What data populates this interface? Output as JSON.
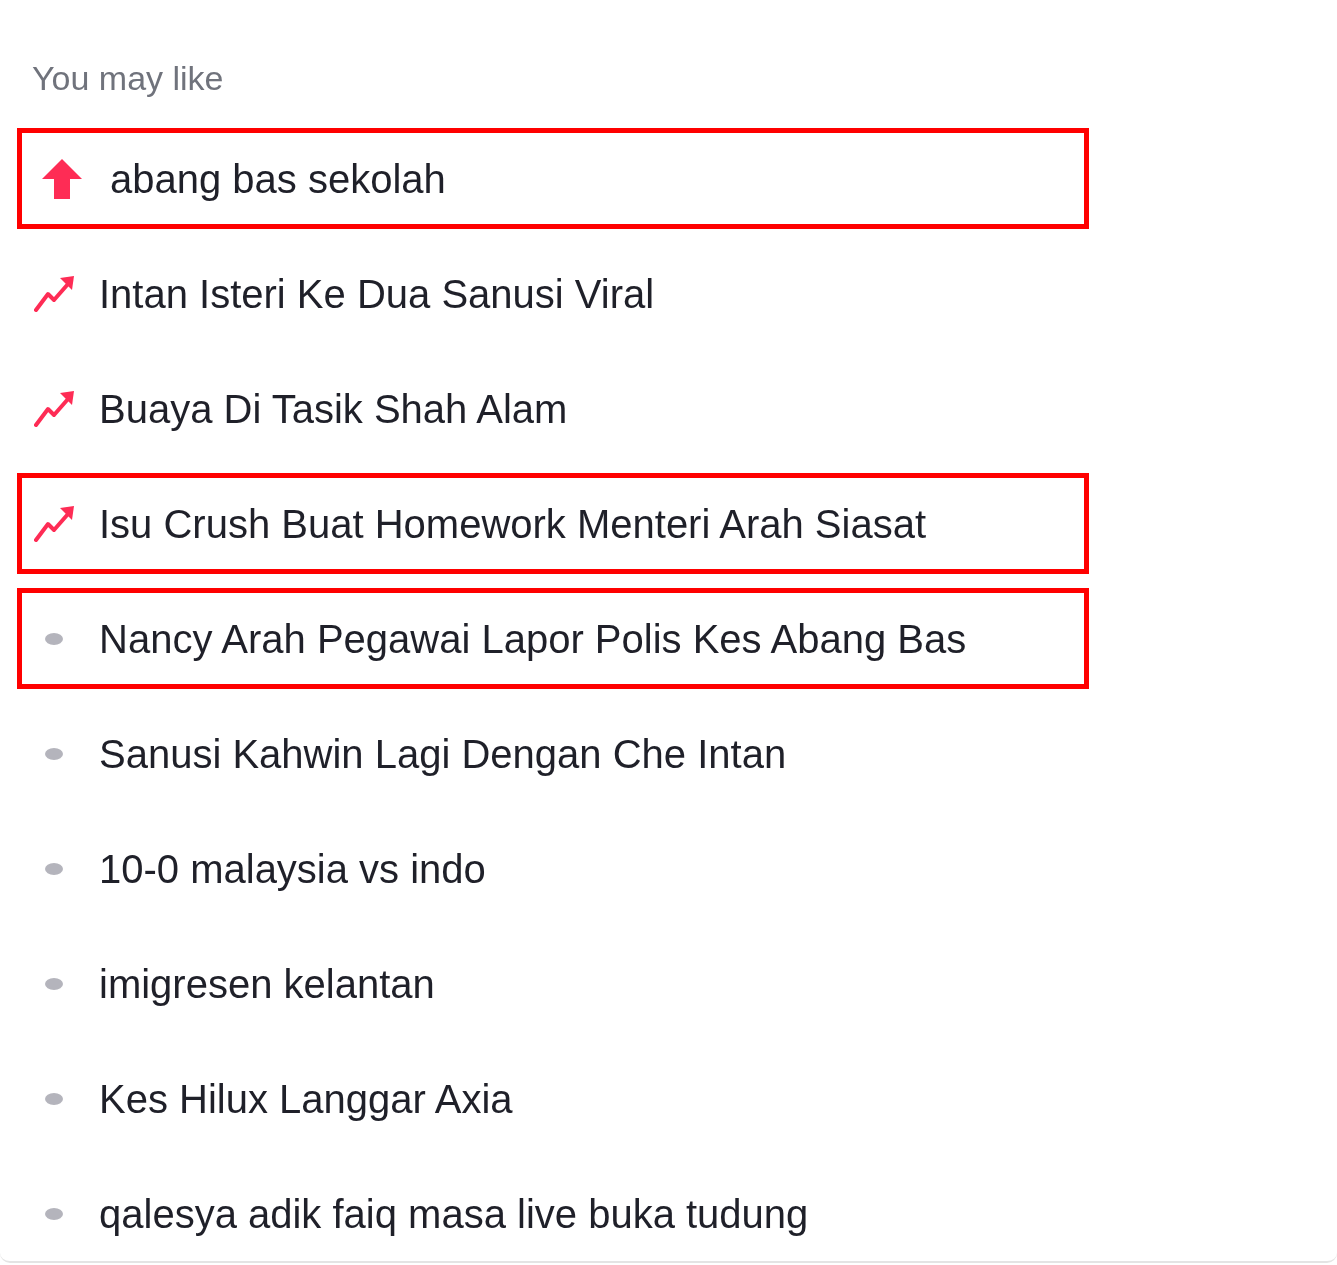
{
  "section": {
    "title": "You may like"
  },
  "items": [
    {
      "kind": "up",
      "label": "abang bas sekolah",
      "highlighted": true
    },
    {
      "kind": "trend",
      "label": "Intan Isteri Ke Dua Sanusi Viral",
      "highlighted": false
    },
    {
      "kind": "trend",
      "label": "Buaya Di Tasik Shah Alam",
      "highlighted": false
    },
    {
      "kind": "trend",
      "label": "Isu Crush Buat Homework Menteri Arah Siasat",
      "highlighted": true
    },
    {
      "kind": "dot",
      "label": "Nancy Arah Pegawai Lapor Polis Kes Abang Bas",
      "highlighted": true
    },
    {
      "kind": "dot",
      "label": "Sanusi Kahwin Lagi Dengan Che Intan",
      "highlighted": false
    },
    {
      "kind": "dot",
      "label": "10-0 malaysia vs indo",
      "highlighted": false
    },
    {
      "kind": "dot",
      "label": "imigresen kelantan",
      "highlighted": false
    },
    {
      "kind": "dot",
      "label": "Kes Hilux Langgar Axia",
      "highlighted": false
    },
    {
      "kind": "dot",
      "label": "qalesya adik faiq masa live buka tudung",
      "highlighted": false
    }
  ]
}
